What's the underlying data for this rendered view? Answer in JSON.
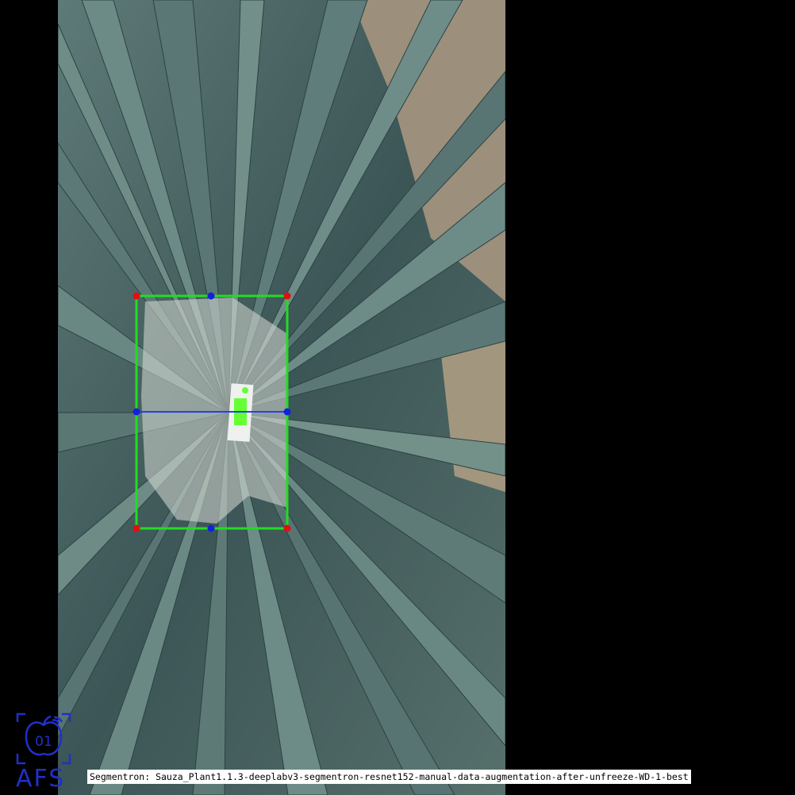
{
  "viewer": {
    "caption": "Segmentron: Sauza_Plant1.1.3-deeplabv3-segmentron-resnet152-manual-data-augmentation-after-unfreeze-WD-1-best",
    "logo_text": "AFS",
    "logo_badge": "01"
  },
  "photo": {
    "subject": "agave plant top view",
    "colors": {
      "leaf": "#4f6d6c",
      "soil": "#a89a86",
      "mask": "#d9dcd6"
    }
  },
  "overlay": {
    "colors": {
      "bbox": "#22dd22",
      "corner_markers": "#dd1111",
      "mid_markers": "#1122dd",
      "axis_line": "#2244ee",
      "tag_highlight": "#66ff33"
    }
  },
  "icons": [
    "apple-01-icon",
    "afs-logo"
  ]
}
